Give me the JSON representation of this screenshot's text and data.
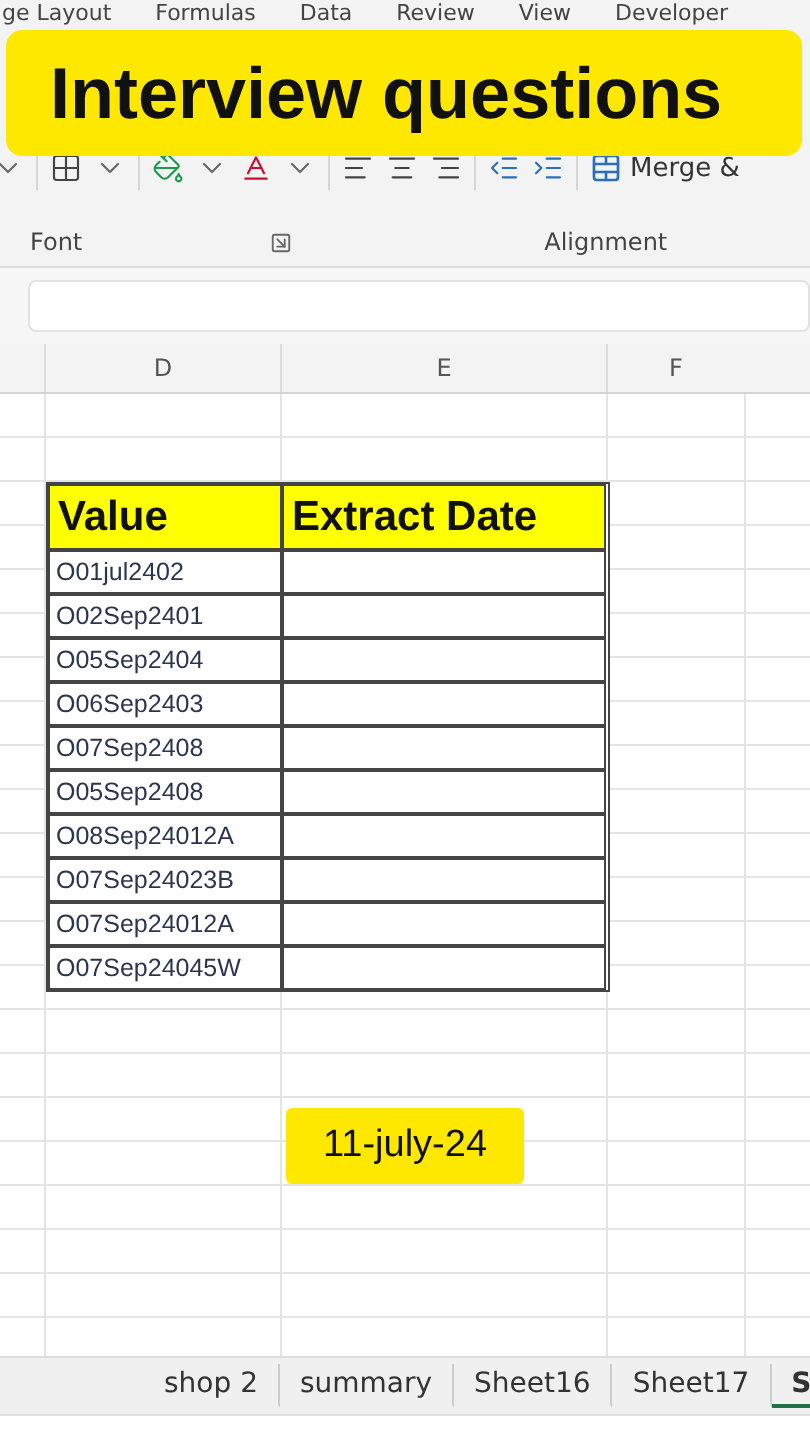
{
  "ribbon_tabs": [
    {
      "label": "ge Layout"
    },
    {
      "label": "Formulas"
    },
    {
      "label": "Data"
    },
    {
      "label": "Review"
    },
    {
      "label": "View"
    },
    {
      "label": "Developer"
    }
  ],
  "banner": {
    "text": "Interview questions"
  },
  "ribbon": {
    "merge_label": "Merge &",
    "groups": [
      "Font",
      "Alignment"
    ]
  },
  "column_headers": [
    "D",
    "E",
    "F"
  ],
  "table": {
    "columns": [
      "Value",
      "Extract Date"
    ],
    "rows": [
      "O01jul2402",
      "O02Sep2401",
      "O05Sep2404",
      "O06Sep2403",
      "O07Sep2408",
      "O05Sep2408",
      "O08Sep24012A",
      "O07Sep24023B",
      "O07Sep24012A",
      "O07Sep24045W"
    ]
  },
  "note": "11-july-24",
  "sheet_tabs": [
    {
      "label": "shop 2",
      "selected": false
    },
    {
      "label": "summary",
      "selected": false
    },
    {
      "label": "Sheet16",
      "selected": false
    },
    {
      "label": "Sheet17",
      "selected": false
    },
    {
      "label": "S",
      "selected": true
    }
  ]
}
